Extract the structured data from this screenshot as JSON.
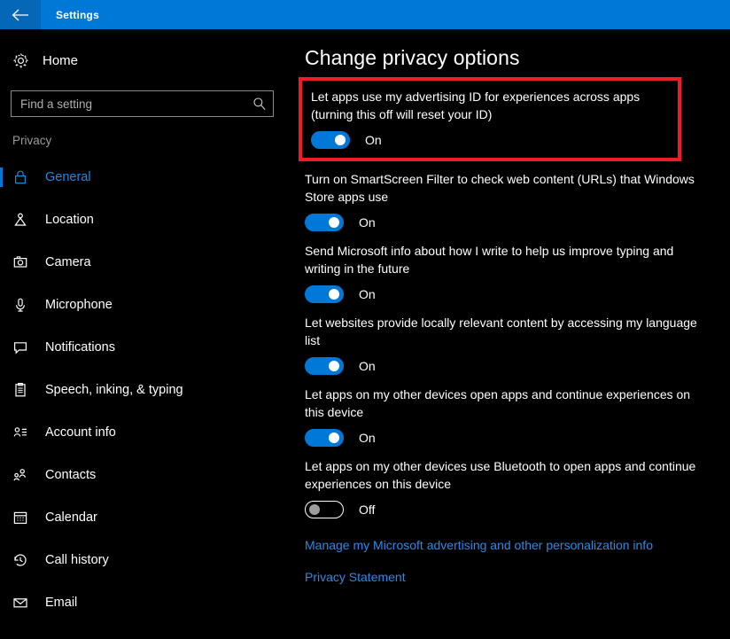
{
  "window": {
    "title": "Settings",
    "back_icon": "back-arrow-icon",
    "accent_color": "#0078d7",
    "background_color": "#000000",
    "highlight_color": "#ee1c25"
  },
  "sidebar": {
    "home": {
      "label": "Home",
      "icon": "gear-icon"
    },
    "search": {
      "placeholder": "Find a setting",
      "value": "",
      "icon": "search-icon"
    },
    "section_label": "Privacy",
    "items": [
      {
        "label": "General",
        "icon": "lock-icon",
        "active": true
      },
      {
        "label": "Location",
        "icon": "location-pin-icon",
        "active": false
      },
      {
        "label": "Camera",
        "icon": "camera-icon",
        "active": false
      },
      {
        "label": "Microphone",
        "icon": "microphone-icon",
        "active": false
      },
      {
        "label": "Notifications",
        "icon": "speech-bubble-icon",
        "active": false
      },
      {
        "label": "Speech, inking, & typing",
        "icon": "clipboard-icon",
        "active": false
      },
      {
        "label": "Account info",
        "icon": "account-info-icon",
        "active": false
      },
      {
        "label": "Contacts",
        "icon": "contacts-icon",
        "active": false
      },
      {
        "label": "Calendar",
        "icon": "calendar-icon",
        "active": false
      },
      {
        "label": "Call history",
        "icon": "call-history-icon",
        "active": false
      },
      {
        "label": "Email",
        "icon": "envelope-icon",
        "active": false
      }
    ]
  },
  "main": {
    "page_title": "Change privacy options",
    "settings": [
      {
        "text": "Let apps use my advertising ID for experiences across apps (turning this off will reset your ID)",
        "state": "On",
        "on": true,
        "highlighted": true
      },
      {
        "text": "Turn on SmartScreen Filter to check web content (URLs) that Windows Store apps use",
        "state": "On",
        "on": true,
        "highlighted": false
      },
      {
        "text": "Send Microsoft info about how I write to help us improve typing and writing in the future",
        "state": "On",
        "on": true,
        "highlighted": false
      },
      {
        "text": "Let websites provide locally relevant content by accessing my language list",
        "state": "On",
        "on": true,
        "highlighted": false
      },
      {
        "text": "Let apps on my other devices open apps and continue experiences on this device",
        "state": "On",
        "on": true,
        "highlighted": false
      },
      {
        "text": "Let apps on my other devices use Bluetooth to open apps and continue experiences on this device",
        "state": "Off",
        "on": false,
        "highlighted": false
      }
    ],
    "links": [
      "Manage my Microsoft advertising and other personalization info",
      "Privacy Statement"
    ]
  }
}
